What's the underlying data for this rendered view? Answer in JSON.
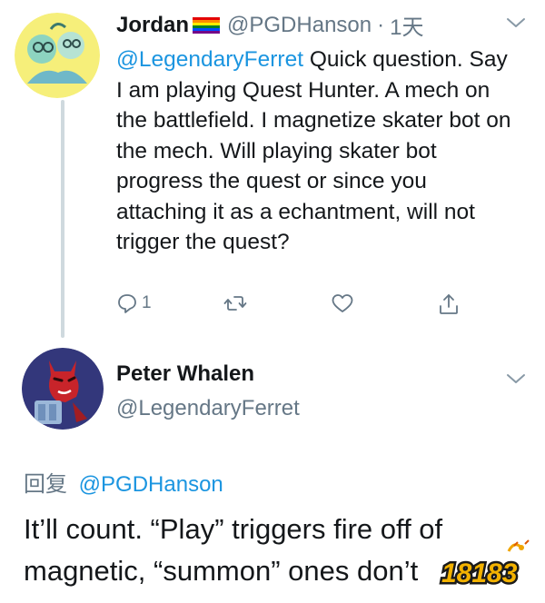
{
  "tweet1": {
    "author_name": "Jordan",
    "handle": "@PGDHanson",
    "separator": "·",
    "time": "1天",
    "mention": "@LegendaryFerret",
    "text": " Quick question. Say I am playing Quest Hunter. A mech on the battlefield. I magnetize skater bot on the mech. Will playing skater bot progress the quest or since you attaching it as a echantment, will not trigger the quest?",
    "reply_count": "1"
  },
  "tweet2": {
    "author_name": "Peter Whalen",
    "handle": "@LegendaryFerret",
    "reply_label": "回复",
    "reply_to": "@PGDHanson",
    "text": "It’ll count. “Play” triggers fire off of magnetic, “summon” ones don’t"
  },
  "watermark": {
    "text": "18183"
  },
  "icons": [
    "chevron-down-icon",
    "reply-icon",
    "retweet-icon",
    "like-icon",
    "share-icon",
    "rainbow-flag-icon"
  ],
  "colors": {
    "link": "#1b95e0",
    "muted": "#657786",
    "text": "#14171a"
  }
}
